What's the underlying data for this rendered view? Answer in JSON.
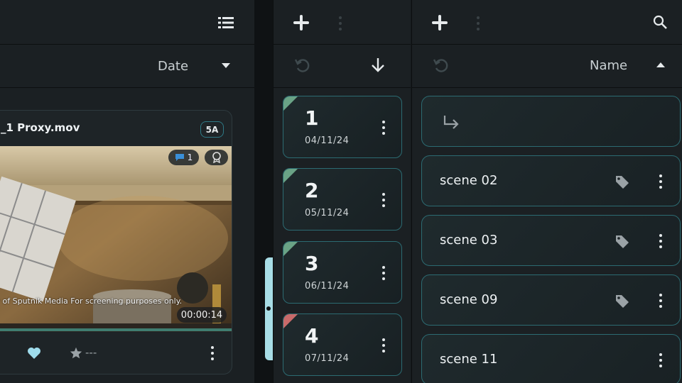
{
  "clips_panel": {
    "sort_label": "Date",
    "clip": {
      "title": "_1 Proxy.mov",
      "badge": "5A",
      "comment_count": "1",
      "watermark": "esy of Sputnik Media For screening purposes only.",
      "timecode": "00:00:14",
      "rating": "---"
    }
  },
  "days_panel": {
    "days": [
      {
        "number": "1",
        "date": "04/11/24",
        "status_color": "#6aa386"
      },
      {
        "number": "2",
        "date": "05/11/24",
        "status_color": "#6aa386"
      },
      {
        "number": "3",
        "date": "06/11/24",
        "status_color": "#6aa386"
      },
      {
        "number": "4",
        "date": "07/11/24",
        "status_color": "#c86a6a"
      }
    ]
  },
  "scenes_panel": {
    "sort_label": "Name",
    "scenes": [
      {
        "name": "scene 02",
        "tagged": true
      },
      {
        "name": "scene 03",
        "tagged": true
      },
      {
        "name": "scene 09",
        "tagged": true
      },
      {
        "name": "scene 11",
        "tagged": false
      }
    ]
  },
  "icons": [
    "list-view-icon",
    "chevron-down-icon",
    "plus-icon",
    "more-vertical-icon",
    "refresh-icon",
    "arrow-down-icon",
    "search-icon",
    "chevron-up-icon",
    "subdirectory-arrow-icon",
    "tag-icon",
    "comment-icon",
    "award-icon",
    "heart-icon",
    "star-icon"
  ]
}
